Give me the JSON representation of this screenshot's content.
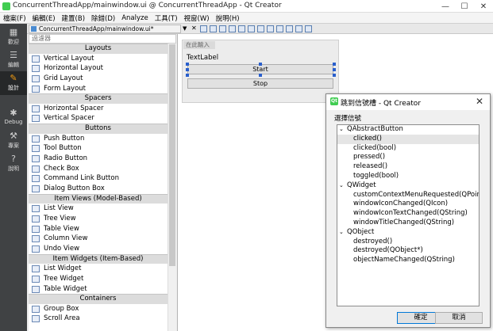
{
  "window": {
    "title": "ConcurrentThreadApp/mainwindow.ui @ ConcurrentThreadApp - Qt Creator",
    "minimize": "—",
    "maximize": "☐",
    "close": "✕"
  },
  "menubar": [
    "檔案(F)",
    "編輯(E)",
    "建置(B)",
    "除錯(D)",
    "Analyze",
    "工具(T)",
    "視窗(W)",
    "說明(H)"
  ],
  "modes": [
    {
      "label": "歡迎",
      "icon": "grid-icon"
    },
    {
      "label": "編輯",
      "icon": "edit-icon"
    },
    {
      "label": "設計",
      "icon": "pencil-icon",
      "active": true
    },
    {
      "label": "Debug",
      "icon": "bug-icon"
    },
    {
      "label": "專案",
      "icon": "wrench-icon"
    },
    {
      "label": "說明",
      "icon": "help-icon"
    }
  ],
  "document": {
    "filename": "ConcurrentThreadApp/mainwindow.ui*"
  },
  "widgetbox": {
    "filter_placeholder": "過濾器",
    "sections": [
      {
        "title": "Layouts",
        "items": [
          "Vertical Layout",
          "Horizontal Layout",
          "Grid Layout",
          "Form Layout"
        ]
      },
      {
        "title": "Spacers",
        "items": [
          "Horizontal Spacer",
          "Vertical Spacer"
        ]
      },
      {
        "title": "Buttons",
        "items": [
          "Push Button",
          "Tool Button",
          "Radio Button",
          "Check Box",
          "Command Link Button",
          "Dialog Button Box"
        ]
      },
      {
        "title": "Item Views (Model-Based)",
        "items": [
          "List View",
          "Tree View",
          "Table View",
          "Column View",
          "Undo View"
        ]
      },
      {
        "title": "Item Widgets (Item-Based)",
        "items": [
          "List Widget",
          "Tree Widget",
          "Table Widget"
        ]
      },
      {
        "title": "Containers",
        "items": [
          "Group Box",
          "Scroll Area"
        ]
      }
    ]
  },
  "form": {
    "menu_placeholder": "在此輸入",
    "label": "TextLabel",
    "start_button": "Start",
    "stop_button": "Stop"
  },
  "dialog": {
    "title": "跳到信號槽 - Qt Creator",
    "select_label": "選擇信號",
    "groups": [
      {
        "name": "QAbstractButton",
        "signals": [
          "clicked()",
          "clicked(bool)",
          "pressed()",
          "released()",
          "toggled(bool)"
        ]
      },
      {
        "name": "QWidget",
        "signals": [
          "customContextMenuRequested(QPoint)",
          "windowIconChanged(QIcon)",
          "windowIconTextChanged(QString)",
          "windowTitleChanged(QString)"
        ]
      },
      {
        "name": "QObject",
        "signals": [
          "destroyed()",
          "destroyed(QObject*)",
          "objectNameChanged(QString)"
        ]
      }
    ],
    "selected": "clicked()",
    "ok_button": "確定",
    "cancel_button": "取消"
  }
}
